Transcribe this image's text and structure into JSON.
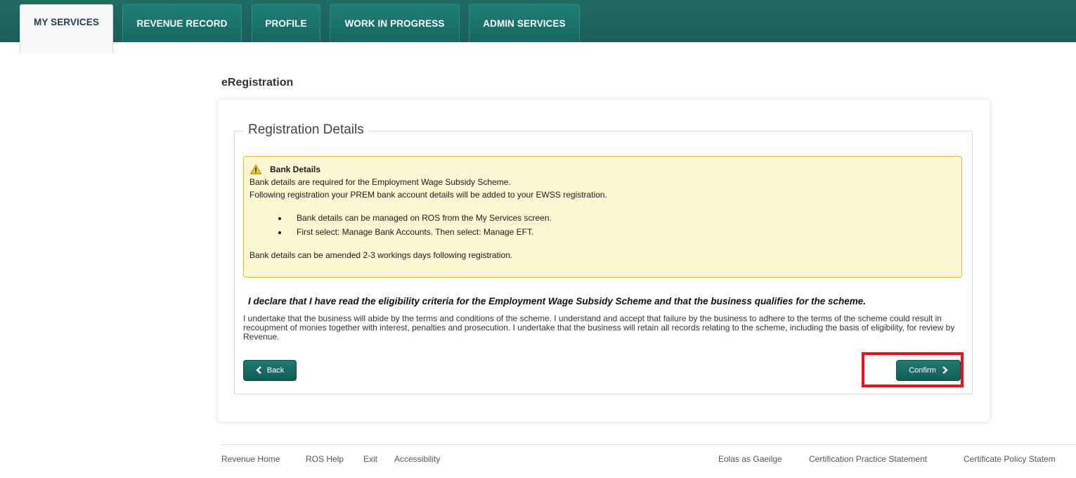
{
  "nav": {
    "tabs": [
      {
        "label": "MY SERVICES",
        "active": true
      },
      {
        "label": "REVENUE RECORD",
        "active": false
      },
      {
        "label": "PROFILE",
        "active": false
      },
      {
        "label": "WORK IN PROGRESS",
        "active": false
      },
      {
        "label": "ADMIN SERVICES",
        "active": false
      }
    ]
  },
  "page": {
    "title": "eRegistration"
  },
  "form": {
    "legend": "Registration Details",
    "alert": {
      "icon": "warning-icon",
      "title": "Bank Details",
      "line1": "Bank details are required for the Employment Wage Subsidy Scheme.",
      "line2": "Following registration your PREM bank account details will be added to your EWSS registration.",
      "bullets": [
        "Bank details can be managed on ROS from the My Services screen.",
        "First select: Manage Bank Accounts. Then select: Manage EFT."
      ],
      "footer": "Bank details can be amended 2-3 workings days following registration."
    },
    "declaration": "I declare that I have read the eligibility criteria for the Employment Wage Subsidy Scheme and that the business qualifies for the scheme.",
    "undertaking": "I undertake that the business will abide by the terms and conditions of the scheme. I understand and accept that failure by the business to adhere to the terms of the scheme could result in recoupment of monies together with interest, penalties and prosecution. I undertake that the business will retain all records relating to the scheme, including the basis of eligibility, for review by Revenue.",
    "back_label": "Back",
    "confirm_label": "Confirm"
  },
  "footer": {
    "left_links": [
      "Revenue Home",
      "ROS Help",
      "Exit",
      "Accessibility"
    ],
    "right_links": [
      "Eolas as Gaeilge",
      "Certification Practice Statement",
      "Certificate Policy Statem"
    ]
  },
  "colors": {
    "nav_bg": "#1b5f57",
    "accent": "#17685f",
    "alert_bg": "#fdf6d3",
    "alert_border": "#e3b64a",
    "highlight": "#e8121c"
  }
}
